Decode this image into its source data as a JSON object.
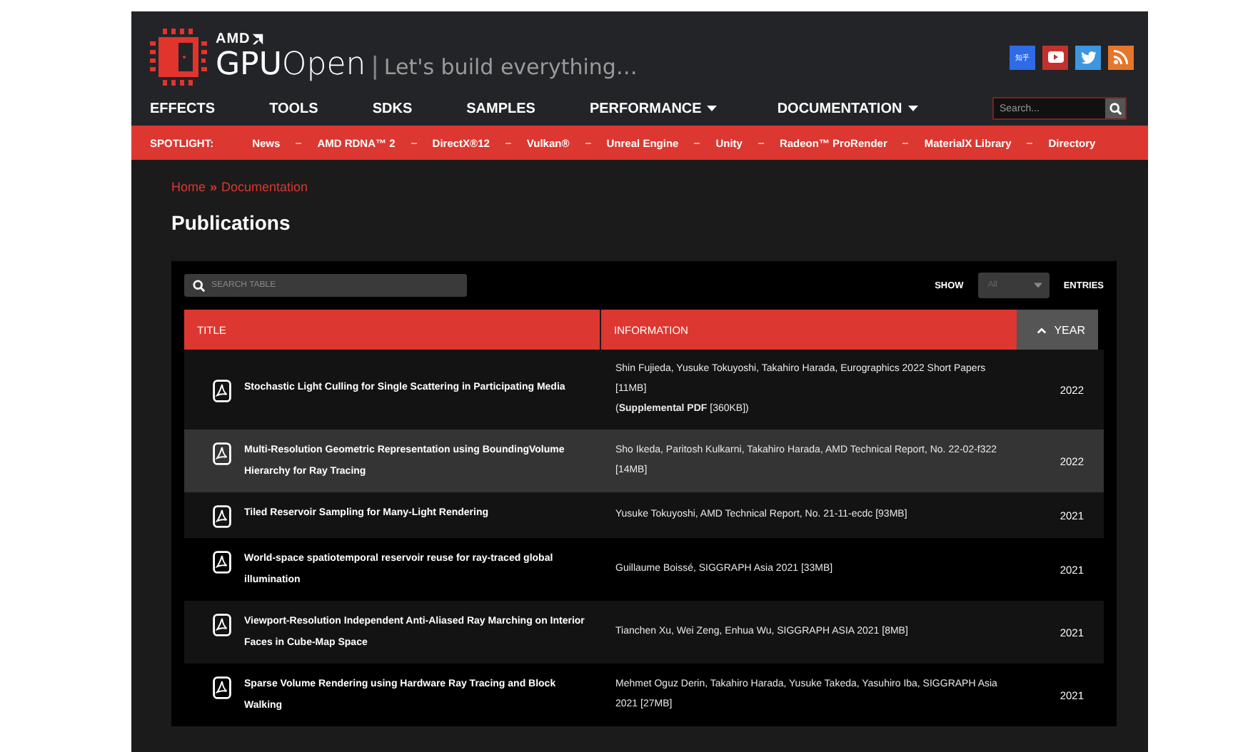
{
  "header": {
    "logo_small": "AMD",
    "brand": "**GPU**Open",
    "separator": "|",
    "tagline": "Let's build everything…",
    "social": [
      {
        "kind": "zhihu",
        "label": "知乎"
      },
      {
        "kind": "youtube"
      },
      {
        "kind": "twitter"
      },
      {
        "kind": "rss"
      }
    ]
  },
  "nav": [
    {
      "label": "EFFECTS",
      "dropdown": false
    },
    {
      "label": "TOOLS",
      "dropdown": false
    },
    {
      "label": "SDKS",
      "dropdown": false
    },
    {
      "label": "SAMPLES",
      "dropdown": false
    },
    {
      "label": "PERFORMANCE",
      "dropdown": true
    },
    {
      "label": "DOCUMENTATION",
      "dropdown": true
    }
  ],
  "search": {
    "placeholder": "Search..."
  },
  "spotlight": {
    "label": "SPOTLIGHT:",
    "items": [
      "News",
      "AMD RDNA™ 2",
      "DirectX®12",
      "Vulkan®",
      "Unreal Engine",
      "Unity",
      "Radeon™ ProRender",
      "MaterialX Library",
      "Directory"
    ]
  },
  "breadcrumb": [
    "Home",
    "»",
    "Documentation"
  ],
  "page_title": "Publications",
  "table": {
    "search_placeholder": "SEARCH TABLE",
    "show_label": "SHOW",
    "show_value": "All",
    "entries_label": "ENTRIES",
    "columns": [
      {
        "label": "TITLE",
        "sorted": false
      },
      {
        "label": "INFORMATION",
        "sorted": false
      },
      {
        "label": "YEAR",
        "sorted": true
      }
    ],
    "rows": [
      {
        "title": "Stochastic Light Culling for Single Scattering in Participating Media",
        "info": [
          "Shin Fujieda, Yusuke Tokuyoshi, Takahiro Harada, Eurographics 2022 Short Papers [11MB]",
          "(**Supplemental PDF** [360KB])"
        ],
        "year": "2022",
        "selected": false
      },
      {
        "title": "Multi-Resolution Geometric Representation using BoundingVolume Hierarchy for Ray Tracing",
        "info": [
          "Sho Ikeda, Paritosh Kulkarni, Takahiro Harada, AMD Technical Report, No. 22-02-f322 [14MB]"
        ],
        "year": "2022",
        "selected": true
      },
      {
        "title": "Tiled Reservoir Sampling for Many-Light Rendering",
        "info": [
          "Yusuke Tokuyoshi, AMD Technical Report, No. 21-11-ecdc [93MB]"
        ],
        "year": "2021",
        "selected": false
      },
      {
        "title": "World-space spatiotemporal reservoir reuse for ray-traced global illumination",
        "info": [
          "Guillaume Boissé, SIGGRAPH Asia 2021 [33MB]"
        ],
        "year": "2021",
        "selected": false
      },
      {
        "title": "Viewport-Resolution Independent Anti-Aliased Ray Marching on Interior Faces in Cube-Map Space",
        "info": [
          "Tianchen Xu, Wei Zeng, Enhua Wu, SIGGRAPH ASIA 2021 [8MB]"
        ],
        "year": "2021",
        "selected": false
      },
      {
        "title": "Sparse Volume Rendering using Hardware Ray Tracing and Block Walking",
        "info": [
          "Mehmet Oguz Derin, Takahiro Harada, Yusuke Takeda, Yasuhiro Iba, SIGGRAPH Asia 2021 [27MB]"
        ],
        "year": "2021",
        "selected": false
      }
    ]
  }
}
